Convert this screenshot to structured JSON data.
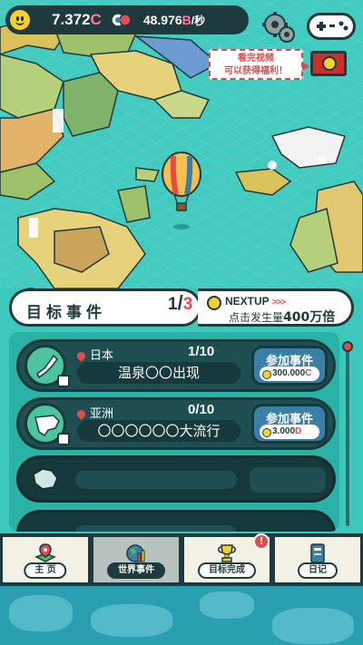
{
  "top_bar": {
    "coins_value": "7.372",
    "coins_unit": "C",
    "rate_value": "48.976",
    "rate_unit": "B",
    "rate_per": "/秒"
  },
  "ad_bubble": {
    "line1": "看完视频",
    "line2": "可以获得福利！"
  },
  "goal": {
    "title": "目标事件",
    "current": "1",
    "total": "3"
  },
  "next_up": {
    "label": "NEXTUP",
    "arrows": ">>>",
    "desc_prefix": "点击发生量",
    "desc_value": "400万倍"
  },
  "events": [
    {
      "region": "日本",
      "count": "1/10",
      "name": "温泉〇〇出现",
      "join_label": "参加事件",
      "cost_value": "300.000",
      "cost_unit": "C"
    },
    {
      "region": "亚洲",
      "count": "0/10",
      "name": "〇〇〇〇〇〇大流行",
      "join_label": "参加事件",
      "cost_value": "3.000",
      "cost_unit": "D"
    }
  ],
  "nav": {
    "home": "主 页",
    "world_events": "世界事件",
    "goal_complete": "目标完成",
    "diary": "日记",
    "alert": "!"
  },
  "colors": {
    "accent_red": "#e84a4a",
    "dark": "#1f3a3c",
    "sea": "#44cbbf",
    "coin_yellow": "#f6d02d"
  }
}
